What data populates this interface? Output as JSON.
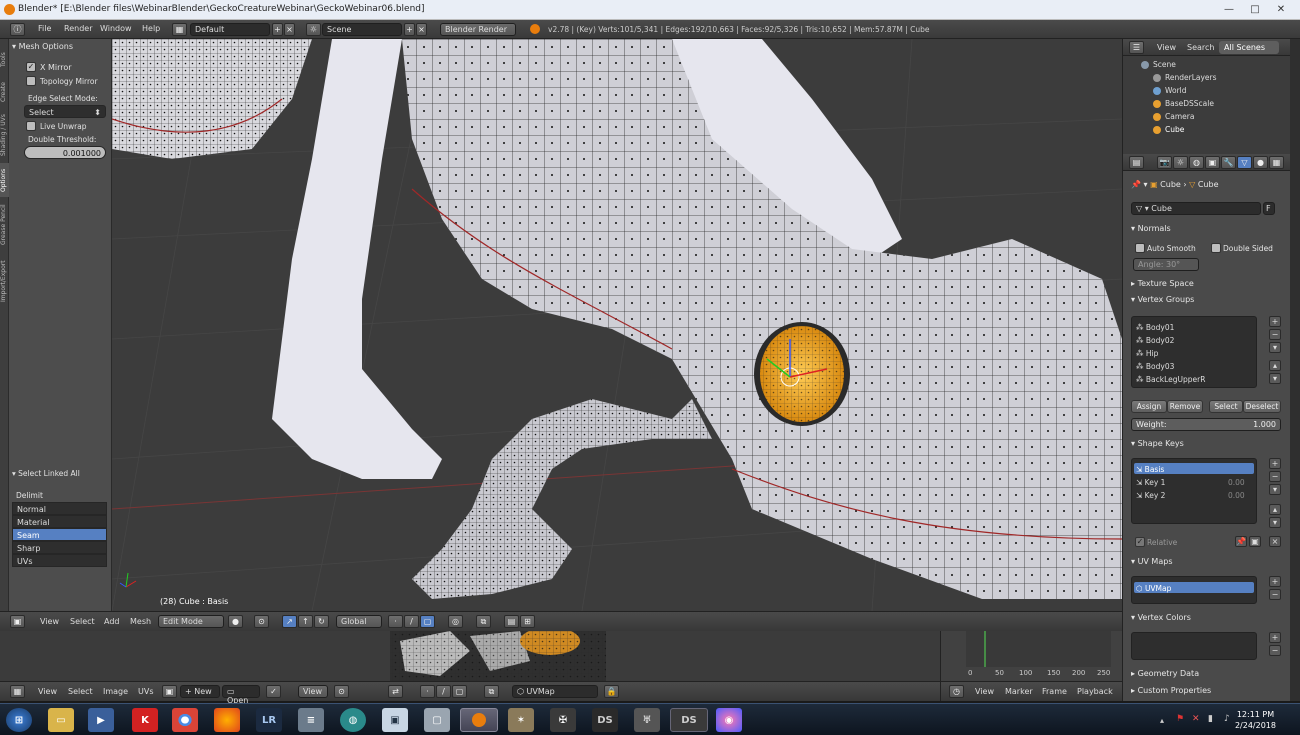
{
  "window": {
    "title": "Blender* [E:\\Blender files\\WebinarBlender\\GeckoCreatureWebinar\\GeckoWebinar06.blend]",
    "minimize": "—",
    "maximize": "□",
    "close": "✕"
  },
  "topmenu": {
    "items": [
      "File",
      "Render",
      "Window",
      "Help"
    ],
    "layout": "Default",
    "scene": "Scene",
    "engine": "Blender Render",
    "stats": "v2.78 | (Key) Verts:101/5,341 | Edges:192/10,663 | Faces:92/5,326 | Tris:10,652 | Mem:57.87M | Cube"
  },
  "toolshelf": {
    "tabs": [
      "Tools",
      "Create",
      "Shading / UVs",
      "Options",
      "Grease Pencil",
      "Import/Export"
    ],
    "mesh_options_title": "Mesh Options",
    "x_mirror": "X Mirror",
    "topology_mirror": "Topology Mirror",
    "edge_select_mode_label": "Edge Select Mode:",
    "edge_select_mode_value": "Select",
    "live_unwrap": "Live Unwrap",
    "double_threshold_label": "Double Threshold:",
    "double_threshold_value": "0.001000",
    "select_linked_title": "Select Linked All",
    "delimit_label": "Delimit",
    "delimit_options": [
      "Normal",
      "Material",
      "Seam",
      "Sharp",
      "UVs"
    ],
    "delimit_selected": "Seam"
  },
  "viewport": {
    "label": "(28) Cube : Basis"
  },
  "view3d_header": {
    "menus": [
      "View",
      "Select",
      "Add",
      "Mesh"
    ],
    "mode": "Edit Mode",
    "orientation": "Global"
  },
  "uv_header": {
    "menus": [
      "View",
      "Select",
      "Image",
      "UVs"
    ],
    "new_label": "New",
    "open_label": "Open",
    "view_label": "View",
    "uvmap": "UVMap"
  },
  "timeline": {
    "ticks": [
      "0",
      "50",
      "100",
      "150",
      "200",
      "250"
    ],
    "menus": [
      "View",
      "Marker",
      "Frame",
      "Playback"
    ]
  },
  "outliner": {
    "tabs": [
      "View",
      "Search",
      "All Scenes"
    ],
    "rows": [
      "Scene",
      "RenderLayers",
      "World",
      "BaseDSScale",
      "Camera",
      "Cube"
    ]
  },
  "properties": {
    "breadcrumb_obj": "Cube",
    "breadcrumb_data": "Cube",
    "mesh_name": "Cube",
    "mesh_fake": "F",
    "normals_title": "Normals",
    "auto_smooth": "Auto Smooth",
    "double_sided": "Double Sided",
    "angle": "Angle:      30°",
    "texture_space": "Texture Space",
    "vertex_groups_title": "Vertex Groups",
    "vertex_groups": [
      "Body01",
      "Body02",
      "Hip",
      "Body03",
      "BackLegUpperR"
    ],
    "assign": "Assign",
    "remove": "Remove",
    "select": "Select",
    "deselect": "Deselect",
    "weight_label": "Weight:",
    "weight_value": "1.000",
    "shape_keys_title": "Shape Keys",
    "shape_keys": [
      "Basis",
      "Key 1",
      "Key 2"
    ],
    "shape_key_values": [
      "",
      "0.00",
      "0.00"
    ],
    "relative": "Relative",
    "uv_maps_title": "UV Maps",
    "uv_maps": [
      "UVMap"
    ],
    "vertex_colors_title": "Vertex Colors",
    "geometry_data": "Geometry Data",
    "custom_properties": "Custom Properties"
  },
  "taskbar": {
    "time": "12:11 PM",
    "date": "2/24/2018",
    "apps": [
      "K",
      "LR",
      "DS",
      "DS"
    ]
  },
  "colors": {
    "accent_blue": "#5680c2",
    "blender_orange": "#e87d0d",
    "panel_gray": "#4a4a4a"
  }
}
